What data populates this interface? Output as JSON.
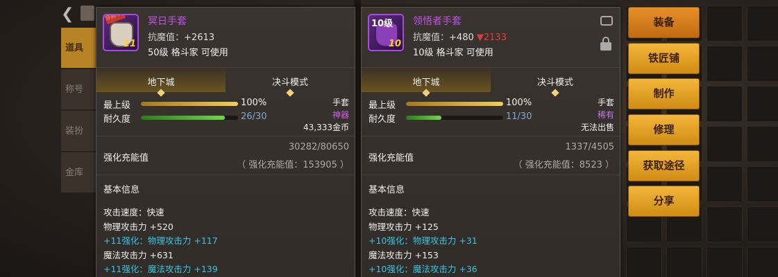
{
  "background": {
    "back_glyph": "❮",
    "sidebar": [
      "道具",
      "称号",
      "装扮",
      "金库"
    ]
  },
  "left_item": {
    "name": "冥日手套",
    "badge": "穿戴中",
    "enhance_level": "11",
    "stat_label": "抗魔值",
    "stat_value": "+2613",
    "stat_up_value": "",
    "stat_down_value": "",
    "requirement": "50级 格斗家 可使用",
    "tabs": [
      "地下城",
      "决斗模式"
    ],
    "max_level_label": "最上级",
    "max_level_value": "100%",
    "max_level_fill": 1.0,
    "durability_label": "耐久度",
    "durability_value": "26/30",
    "durability_fill": 0.8667,
    "type": "手套",
    "grade": "神器",
    "price": "43,333金币",
    "enhance_label": "强化充能值",
    "enhance_value": "30282/80650",
    "enhance_sub": "（ 强化充能值：153905 ）",
    "basic_title": "基本信息",
    "lines": [
      {
        "text": "攻击速度：快速",
        "cyan": false
      },
      {
        "text": "物理攻击力 +520",
        "cyan": false
      },
      {
        "text": "+11强化：物理攻击力 +117",
        "cyan": true
      },
      {
        "text": "魔法攻击力 +631",
        "cyan": false
      },
      {
        "text": "+11强化：魔法攻击力 +139",
        "cyan": true
      }
    ]
  },
  "right_item": {
    "name": "领悟者手套",
    "level_label": "10级",
    "enhance_level": "10",
    "stat_label": "抗魔值",
    "stat_value": "+480",
    "stat_down_value": "▼2133",
    "requirement": "10级 格斗家 可使用",
    "tabs": [
      "地下城",
      "决斗模式"
    ],
    "max_level_label": "最上级",
    "max_level_value": "100%",
    "max_level_fill": 1.0,
    "durability_label": "耐久度",
    "durability_value": "11/30",
    "durability_fill": 0.3667,
    "type": "手套",
    "grade": "稀有",
    "price": "无法出售",
    "enhance_label": "强化充能值",
    "enhance_value": "1337/4505",
    "enhance_sub": "（ 强化充能值：8523 ）",
    "basic_title": "基本信息",
    "lines": [
      {
        "text": "攻击速度：快速",
        "cyan": false
      },
      {
        "text": "物理攻击力 +125",
        "cyan": false
      },
      {
        "text": "+10强化：物理攻击力 +31",
        "cyan": true
      },
      {
        "text": "魔法攻击力 +153",
        "cyan": false
      },
      {
        "text": "+10强化：魔法攻击力 +36",
        "cyan": true
      }
    ]
  },
  "actions": [
    "装备",
    "铁匠铺",
    "制作",
    "修理",
    "获取途径",
    "分享"
  ]
}
